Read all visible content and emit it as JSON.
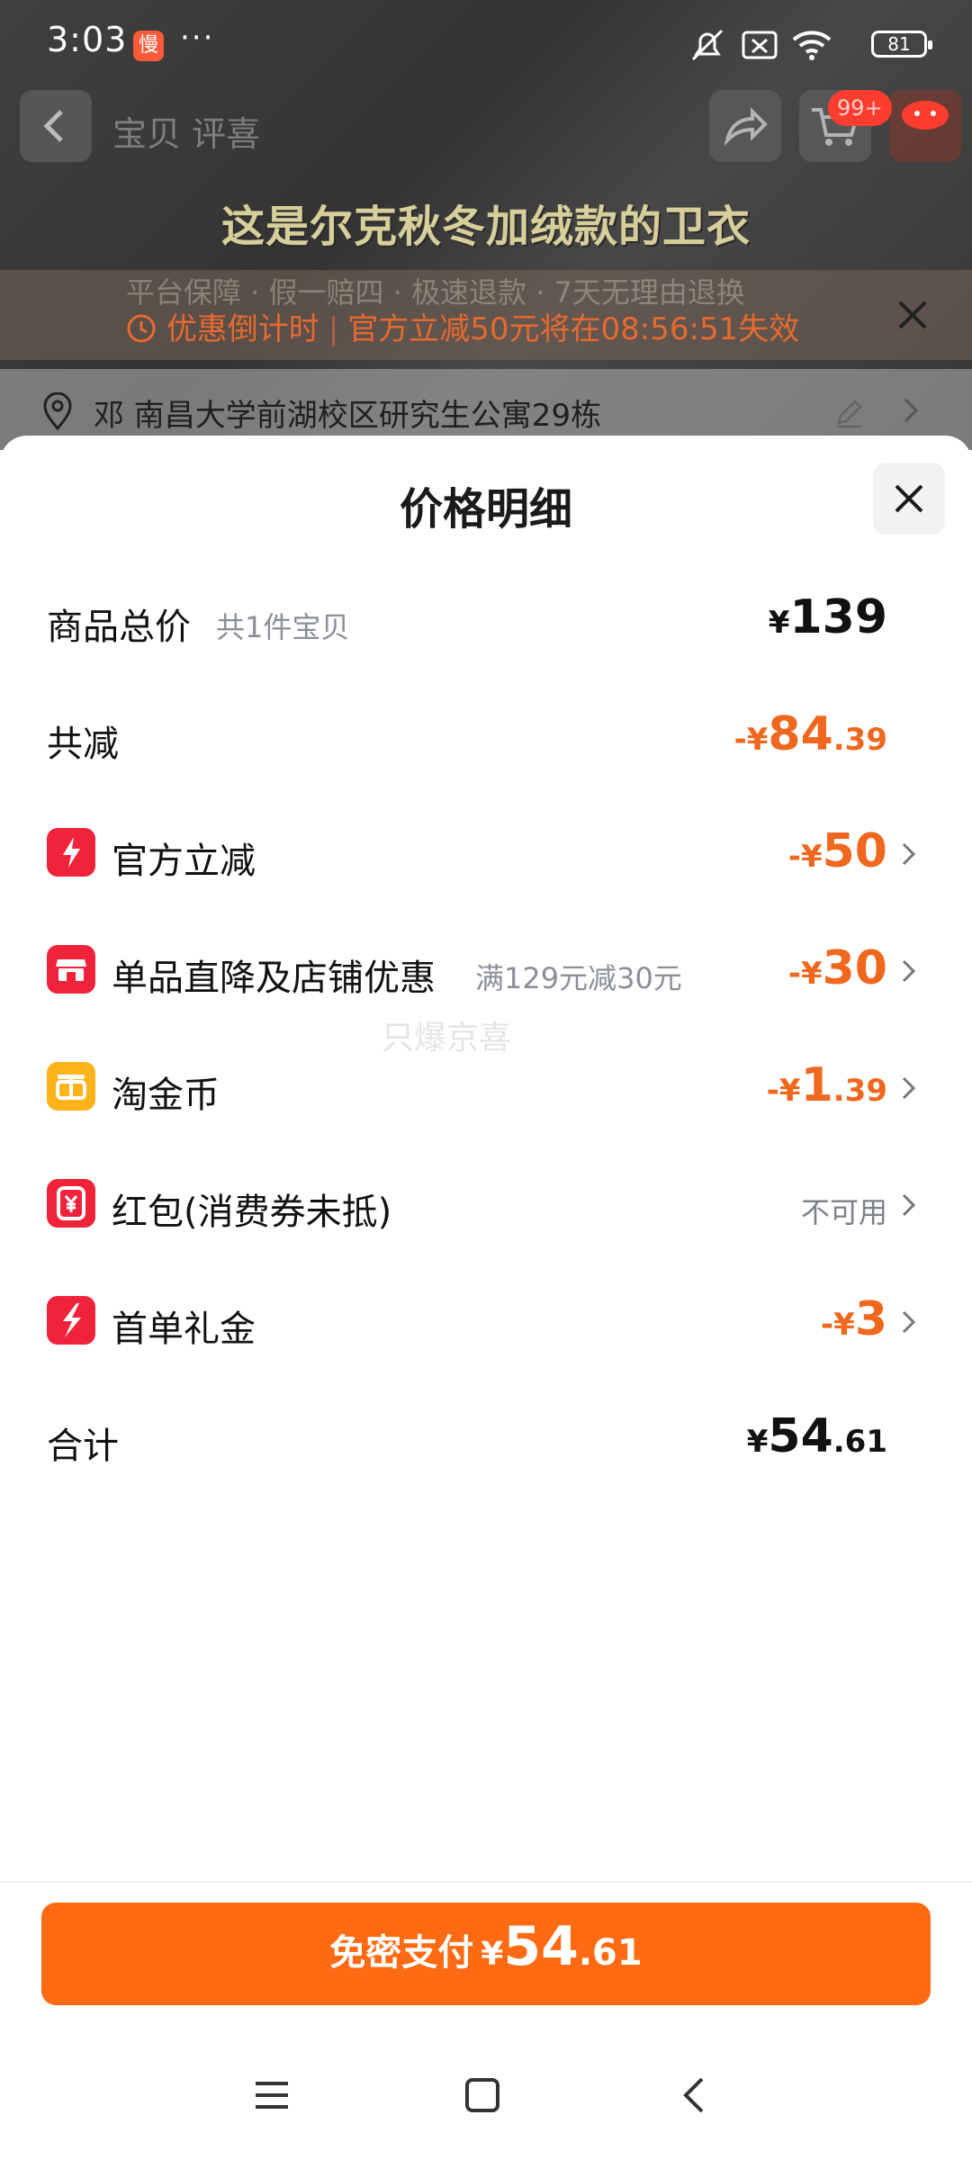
{
  "status_bar": {
    "time": "3:03",
    "app_badge": "慢",
    "dots": "···",
    "battery": "81"
  },
  "background": {
    "nav_tabs": "宝贝  评喜",
    "cart_badge": "99+",
    "hero_caption": "这是尔克秋冬加绒款的卫衣",
    "guarantee": "平台保障 · 假一赔四 · 极速退款 · 7天无理由退换",
    "countdown_label": "优惠倒计时",
    "countdown_text": "官方立减50元将在08:56:51失效",
    "address": "邓  南昌大学前湖校区研究生公寓29栋"
  },
  "sheet": {
    "title": "价格明细",
    "rows": {
      "total": {
        "label": "商品总价",
        "sub": "共1件宝贝",
        "cur": "¥",
        "int": "139",
        "dec": ""
      },
      "reduce": {
        "label": "共减",
        "cur": "-¥",
        "int": "84",
        "dec": ".39"
      },
      "official": {
        "label": "官方立减",
        "cur": "-¥",
        "int": "50",
        "dec": ""
      },
      "store": {
        "label": "单品直降及店铺优惠",
        "sub": "满129元减30元",
        "cur": "-¥",
        "int": "30",
        "dec": ""
      },
      "coins": {
        "label": "淘金币",
        "cur": "-¥",
        "int": "1",
        "dec": ".39"
      },
      "redpacket": {
        "label": "红包(消费券未抵)",
        "status": "不可用"
      },
      "firstorder": {
        "label": "首单礼金",
        "cur": "-¥",
        "int": "3",
        "dec": ""
      },
      "sum": {
        "label": "合计",
        "cur": "¥",
        "int": "54",
        "dec": ".61"
      }
    },
    "watermark": "只爆京喜"
  },
  "pay_button": {
    "label": "免密支付",
    "cur": "¥",
    "int": "54",
    "dec": ".61"
  },
  "colors": {
    "accent": "#ff6a13",
    "discount": "#f0671e",
    "icon_red": "#f0233a",
    "icon_yellow": "#ffb31a"
  },
  "icons": {
    "official": "lightning-icon",
    "store": "store-icon",
    "coins": "coin-icon",
    "redpacket": "red-packet-icon",
    "firstorder": "gift-cash-icon"
  }
}
